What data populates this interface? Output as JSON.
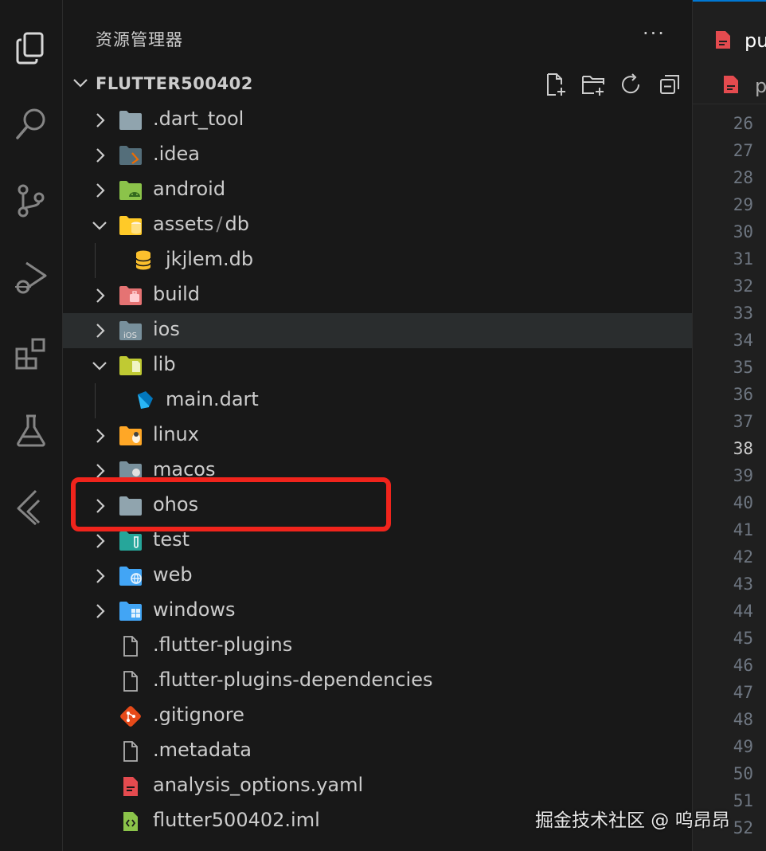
{
  "sidebar": {
    "title": "资源管理器",
    "more_label": "···",
    "workspace": "FLUTTER500402",
    "items": [
      {
        "label": ".dart_tool",
        "kind": "folder",
        "expanded": false,
        "icon": "folder-icon"
      },
      {
        "label": ".idea",
        "kind": "folder",
        "expanded": false,
        "icon": "idea-folder-icon"
      },
      {
        "label": "android",
        "kind": "folder",
        "expanded": false,
        "icon": "android-folder-icon"
      },
      {
        "label": "assets",
        "label_suffix": "db",
        "kind": "folder",
        "expanded": true,
        "icon": "assets-folder-icon"
      },
      {
        "label": "jkjlem.db",
        "kind": "file",
        "icon": "database-icon"
      },
      {
        "label": "build",
        "kind": "folder",
        "expanded": false,
        "icon": "build-folder-icon"
      },
      {
        "label": "ios",
        "kind": "folder",
        "expanded": false,
        "icon": "ios-folder-icon",
        "selected": true
      },
      {
        "label": "lib",
        "kind": "folder",
        "expanded": true,
        "icon": "lib-folder-icon"
      },
      {
        "label": "main.dart",
        "kind": "file",
        "icon": "dart-icon"
      },
      {
        "label": "linux",
        "kind": "folder",
        "expanded": false,
        "icon": "linux-folder-icon"
      },
      {
        "label": "macos",
        "kind": "folder",
        "expanded": false,
        "icon": "macos-folder-icon"
      },
      {
        "label": "ohos",
        "kind": "folder",
        "expanded": false,
        "icon": "folder-icon"
      },
      {
        "label": "test",
        "kind": "folder",
        "expanded": false,
        "icon": "test-folder-icon"
      },
      {
        "label": "web",
        "kind": "folder",
        "expanded": false,
        "icon": "web-folder-icon"
      },
      {
        "label": "windows",
        "kind": "folder",
        "expanded": false,
        "icon": "windows-folder-icon"
      },
      {
        "label": ".flutter-plugins",
        "kind": "file",
        "icon": "file-icon"
      },
      {
        "label": ".flutter-plugins-dependencies",
        "kind": "file",
        "icon": "file-icon"
      },
      {
        "label": ".gitignore",
        "kind": "file",
        "icon": "git-icon"
      },
      {
        "label": ".metadata",
        "kind": "file",
        "icon": "file-icon"
      },
      {
        "label": "analysis_options.yaml",
        "kind": "file",
        "icon": "yaml-icon"
      },
      {
        "label": "flutter500402.iml",
        "kind": "file",
        "icon": "iml-icon"
      }
    ]
  },
  "editor": {
    "tab_label": "pu",
    "breadcrumb_label": "p",
    "line_numbers": [
      "26",
      "27",
      "28",
      "29",
      "30",
      "31",
      "32",
      "33",
      "34",
      "35",
      "36",
      "37",
      "38",
      "39",
      "40",
      "41",
      "42",
      "43",
      "44",
      "45",
      "46",
      "47",
      "48",
      "49",
      "50",
      "51",
      "52"
    ],
    "current_line": "38"
  },
  "watermark": "掘金技术社区 @ 呜昂昂",
  "colors": {
    "highlight": "#f0241c",
    "selection": "#2a2d2e",
    "accent": "#0078d4"
  }
}
